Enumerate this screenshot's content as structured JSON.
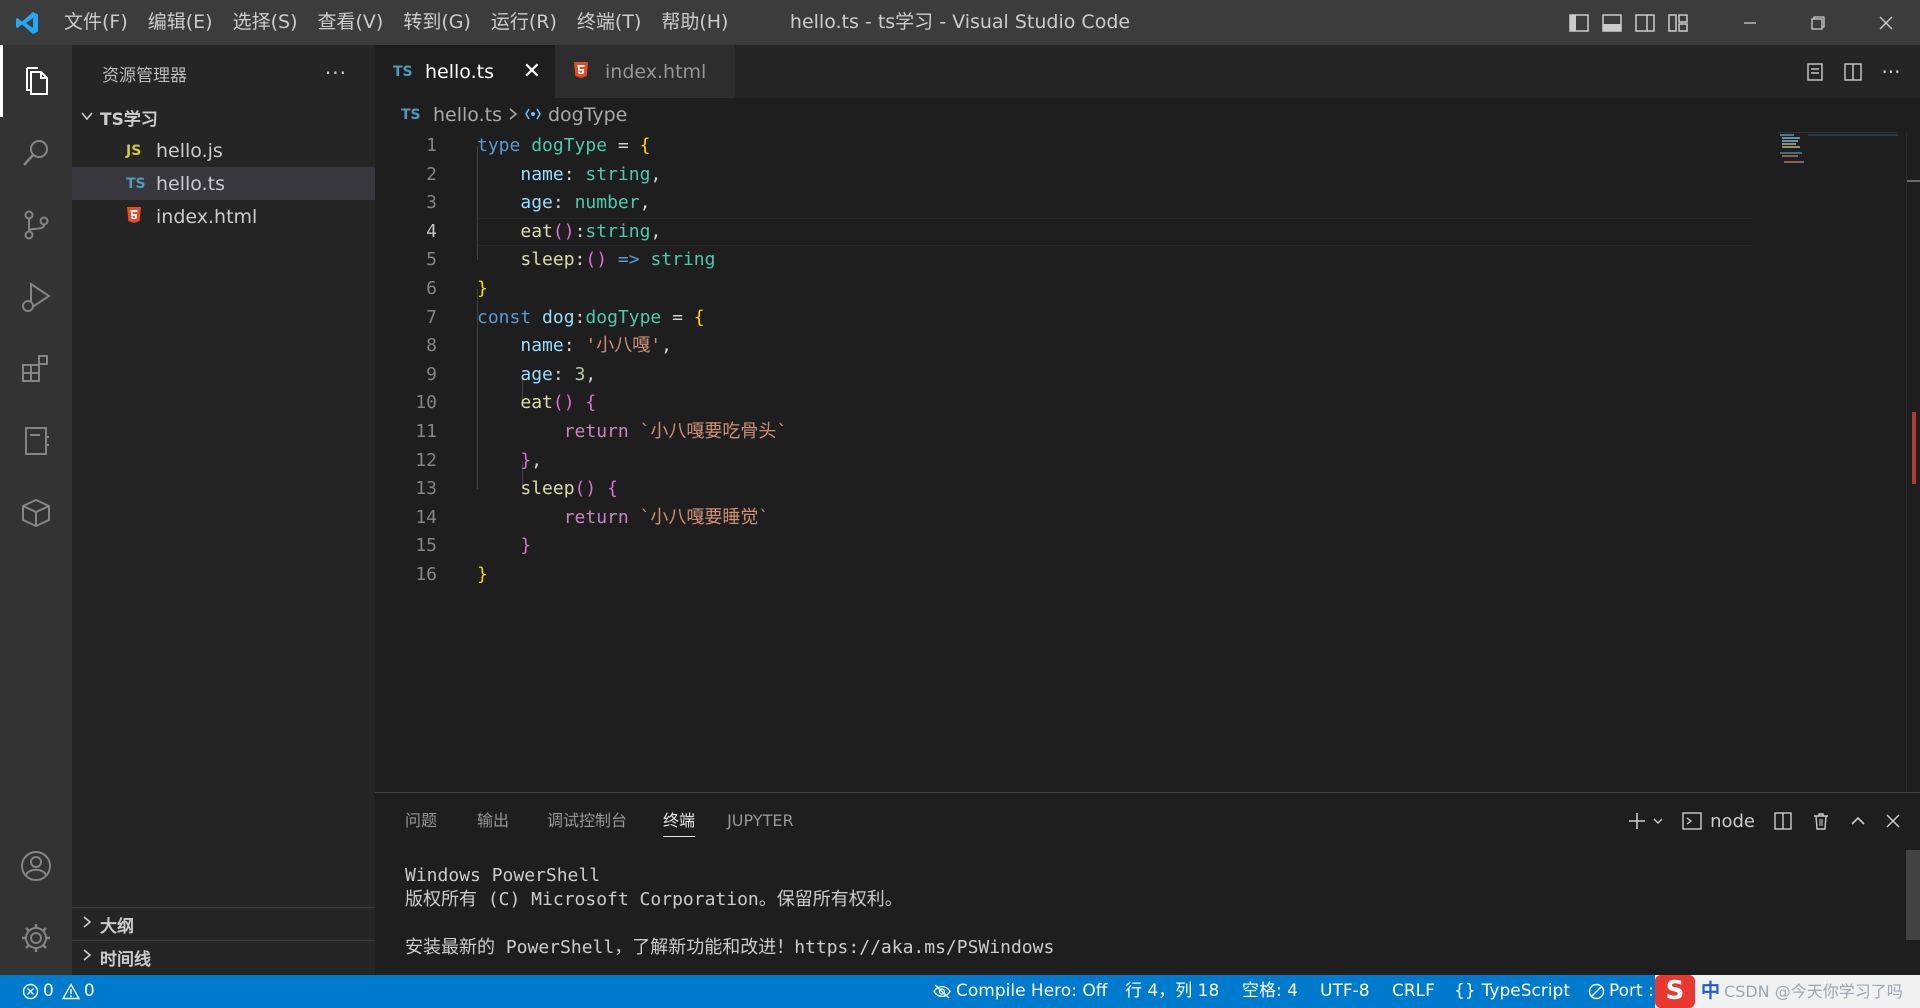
{
  "window": {
    "title": "hello.ts - ts学习 - Visual Studio Code"
  },
  "menu": [
    "文件(F)",
    "编辑(E)",
    "选择(S)",
    "查看(V)",
    "转到(G)",
    "运行(R)",
    "终端(T)",
    "帮助(H)"
  ],
  "sidebar": {
    "title": "资源管理器",
    "folder": "TS学习",
    "files": [
      {
        "name": "hello.js",
        "icon": "JS"
      },
      {
        "name": "hello.ts",
        "icon": "TS"
      },
      {
        "name": "index.html",
        "icon": "html"
      }
    ],
    "sections": [
      "大纲",
      "时间线"
    ]
  },
  "tabs": [
    {
      "label": "hello.ts",
      "icon": "TS"
    },
    {
      "label": "index.html",
      "icon": "html"
    }
  ],
  "breadcrumb": {
    "file": "hello.ts",
    "symbol": "dogType",
    "file_icon": "TS"
  },
  "editor": {
    "line_numbers": [
      "1",
      "2",
      "3",
      "4",
      "5",
      "6",
      "7",
      "8",
      "9",
      "10",
      "11",
      "12",
      "13",
      "14",
      "15",
      "16"
    ],
    "current_line": 4,
    "tokens": [
      [
        "type",
        " ",
        "dogType",
        " = ",
        "{"
      ],
      [
        "    ",
        "name",
        ": ",
        "string",
        ","
      ],
      [
        "    ",
        "age",
        ": ",
        "number",
        ","
      ],
      [
        "    ",
        "eat",
        "()",
        ":",
        "string",
        ","
      ],
      [
        "    ",
        "sleep",
        ":",
        "()",
        " => ",
        "string"
      ],
      [
        "}"
      ],
      [
        "const",
        " ",
        "dog",
        ":",
        "dogType",
        " = ",
        "{"
      ],
      [
        "    ",
        "name",
        ": ",
        "'小八嘎'",
        ","
      ],
      [
        "    ",
        "age",
        ": ",
        "3",
        ","
      ],
      [
        "    ",
        "eat",
        "()",
        " ",
        "{"
      ],
      [
        "        ",
        "return",
        " ",
        "`小八嘎要吃骨头`"
      ],
      [
        "    ",
        "}",
        ","
      ],
      [
        "    ",
        "sleep",
        "()",
        " ",
        "{"
      ],
      [
        "        ",
        "return",
        " ",
        "`小八嘎要睡觉`"
      ],
      [
        "    ",
        "}"
      ],
      [
        "}"
      ]
    ]
  },
  "panel": {
    "tabs": [
      "问题",
      "输出",
      "调试控制台",
      "终端",
      "JUPYTER"
    ],
    "active_tab": "终端",
    "shell": "node",
    "terminal_lines": [
      "Windows PowerShell",
      "版权所有 (C) Microsoft Corporation。保留所有权利。",
      "",
      "安装最新的 PowerShell，了解新功能和改进！https://aka.ms/PSWindows"
    ]
  },
  "statusbar": {
    "errors": "0",
    "warnings": "0",
    "compile_hero": "Compile Hero: Off",
    "cursor": "行 4，列 18",
    "spaces": "空格: 4",
    "encoding": "UTF-8",
    "eol": "CRLF",
    "language": "TypeScript",
    "port": "Port :",
    "watermark": "CSDN @今天你学习了吗"
  },
  "colors": {
    "accent": "#007acc",
    "titlebar": "#3c3c3c",
    "editor_bg": "#1e1e1e",
    "sidebar_bg": "#252526"
  },
  "icons": {
    "activity": [
      "explorer-icon",
      "search-icon",
      "source-control-icon",
      "run-debug-icon",
      "extensions-icon",
      "notebook-icon",
      "package-icon",
      "account-icon",
      "settings-gear-icon"
    ]
  }
}
